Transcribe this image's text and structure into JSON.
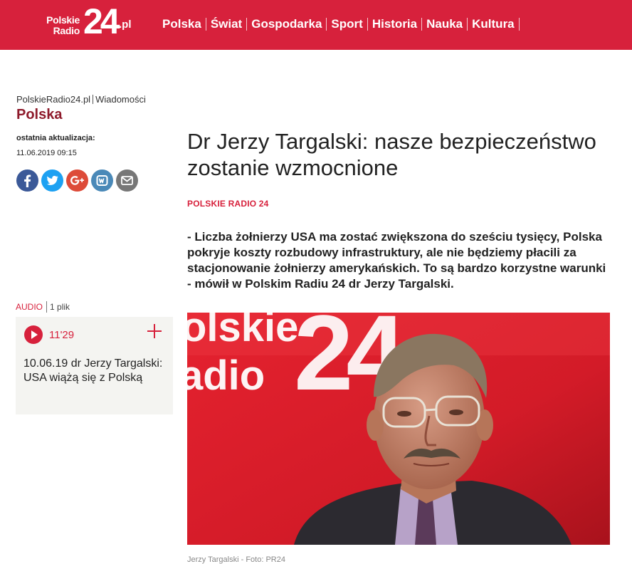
{
  "header": {
    "logo": {
      "line1": "Polskie",
      "line2": "Radio",
      "number": "24",
      "domain": ".pl"
    },
    "nav": [
      "Polska",
      "Świat",
      "Gospodarka",
      "Sport",
      "Historia",
      "Nauka",
      "Kultura"
    ]
  },
  "breadcrumb": {
    "site": "PolskieRadio24.pl",
    "category": "Wiadomości"
  },
  "section": "Polska",
  "update": {
    "label": "ostatnia aktualizacja:",
    "date": "11.06.2019 09:15"
  },
  "share_icons": [
    "facebook-icon",
    "twitter-icon",
    "google-plus-icon",
    "wykop-icon",
    "mail-icon"
  ],
  "audio": {
    "label": "AUDIO",
    "count": "1 plik",
    "duration": "11'29",
    "title": "10.06.19 dr Jerzy Targalski: USA wiążą się z Polską"
  },
  "article": {
    "title": "Dr Jerzy Targalski: nasze bezpieczeństwo zostanie wzmocnione",
    "source": "POLSKIE RADIO 24",
    "lead": "- Liczba żołnierzy USA ma zostać zwiększona do sześciu tysięcy, Polska pokryje koszty rozbudowy infrastruktury, ale nie będziemy płacili za stacjonowanie żołnierzy amerykańskich. To są bardzo korzystne warunki - mówił w Polskim Radiu 24 dr Jerzy Targalski.",
    "photo": {
      "backdrop_text_1": "olskie",
      "backdrop_text_2": "adio",
      "backdrop_number": "24"
    },
    "caption": "Jerzy Targalski - Foto: PR24"
  },
  "colors": {
    "brand": "#d7213c",
    "section": "#8e1a2b",
    "card_bg": "#f4f4f1"
  }
}
